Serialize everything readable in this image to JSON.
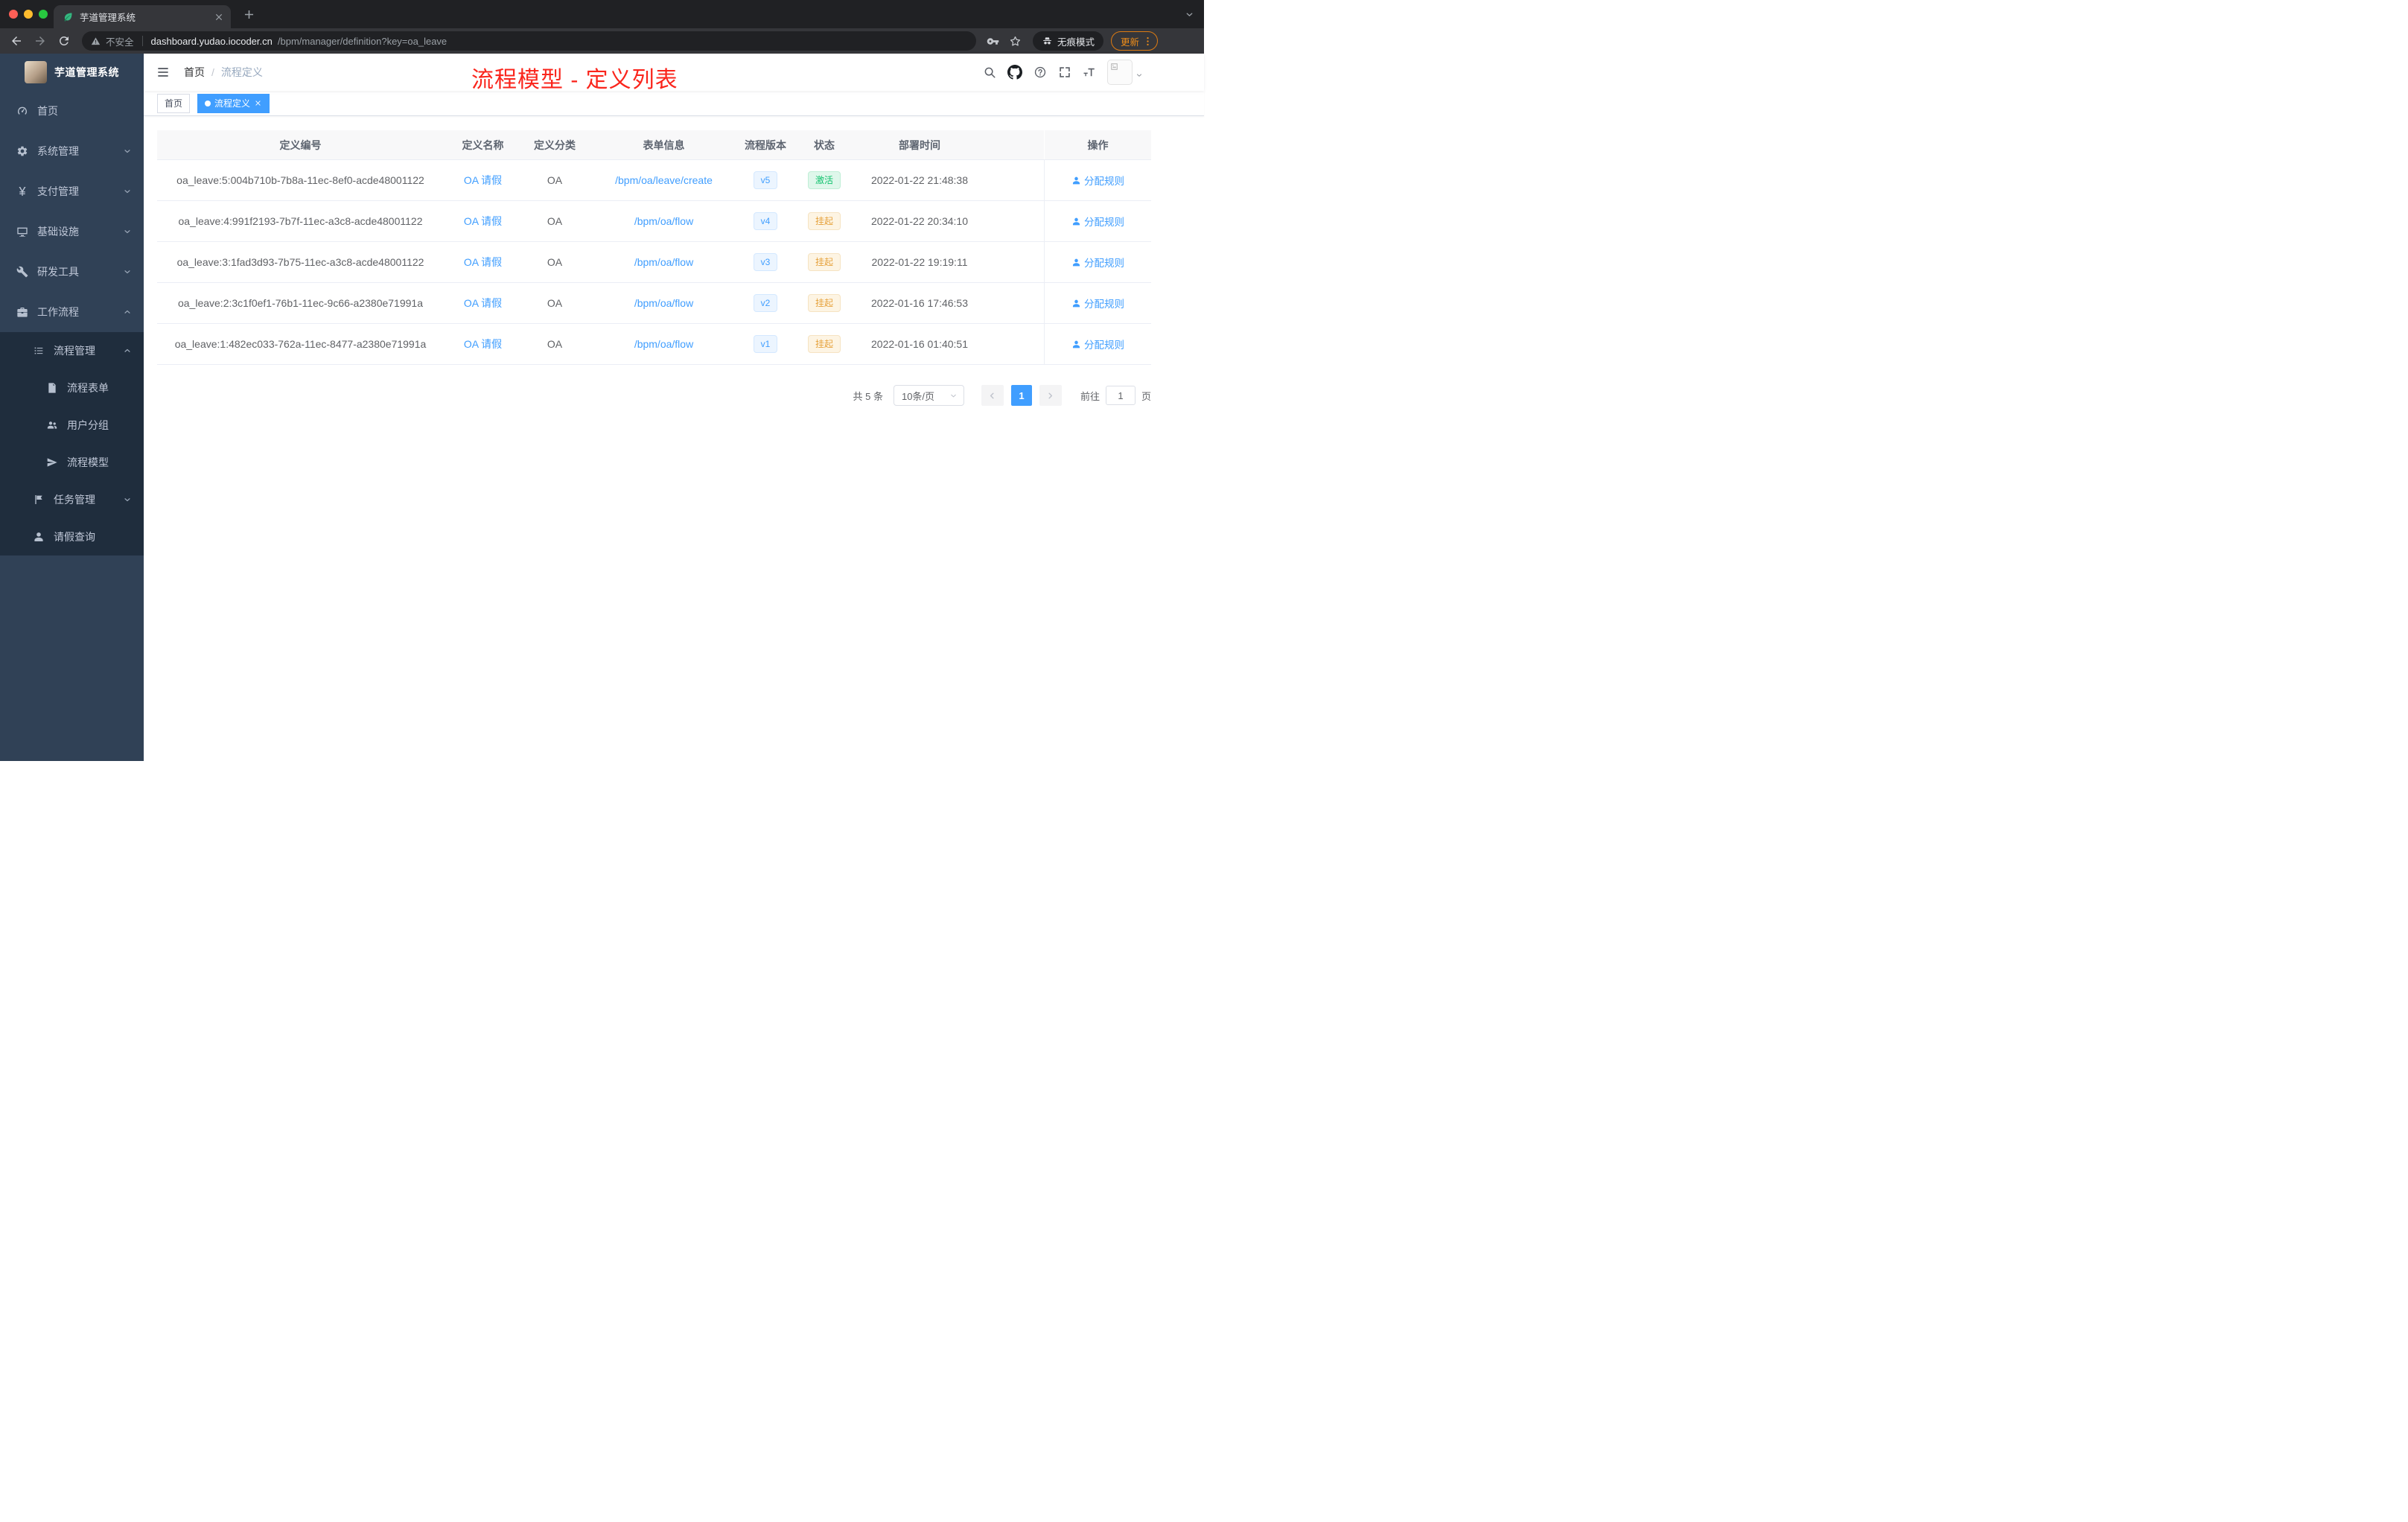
{
  "browser": {
    "tab_title": "芋道管理系统",
    "security_label": "不安全",
    "url_domain": "dashboard.yudao.iocoder.cn",
    "url_path": "/bpm/manager/definition?key=oa_leave",
    "incognito_label": "无痕模式",
    "update_label": "更新"
  },
  "sidebar": {
    "logo_title": "芋道管理系统",
    "items": [
      {
        "key": "home",
        "label": "首页",
        "icon": "dashboard",
        "level": 0
      },
      {
        "key": "system",
        "label": "系统管理",
        "icon": "gear",
        "level": 0,
        "chevron": "down"
      },
      {
        "key": "payment",
        "label": "支付管理",
        "icon": "yen",
        "level": 0,
        "chevron": "down"
      },
      {
        "key": "infrastructure",
        "label": "基础设施",
        "icon": "infra",
        "level": 0,
        "chevron": "down"
      },
      {
        "key": "dev-tools",
        "label": "研发工具",
        "icon": "tools",
        "level": 0,
        "chevron": "down"
      },
      {
        "key": "workflow",
        "label": "工作流程",
        "icon": "workflow",
        "level": 0,
        "chevron": "up"
      },
      {
        "key": "process-management",
        "label": "流程管理",
        "icon": "process",
        "level": 1,
        "chevron": "up",
        "sub": true
      },
      {
        "key": "process-form",
        "label": "流程表单",
        "icon": "form",
        "level": 2,
        "sub": true
      },
      {
        "key": "user-group",
        "label": "用户分组",
        "icon": "user-group",
        "level": 2,
        "sub": true
      },
      {
        "key": "process-model",
        "label": "流程模型",
        "icon": "paper-plane",
        "level": 2,
        "sub": true
      },
      {
        "key": "task-management",
        "label": "任务管理",
        "icon": "task",
        "level": 1,
        "chevron": "down",
        "sub": true
      },
      {
        "key": "leave-query",
        "label": "请假查询",
        "icon": "person",
        "level": 1,
        "sub": true
      }
    ]
  },
  "header": {
    "breadcrumb": [
      "首页",
      "流程定义"
    ],
    "separator": "/",
    "annotation": "流程模型 - 定义列表"
  },
  "tags": [
    {
      "label": "首页",
      "active": false
    },
    {
      "label": "流程定义",
      "active": true
    }
  ],
  "table": {
    "columns": [
      "定义编号",
      "定义名称",
      "定义分类",
      "表单信息",
      "流程版本",
      "状态",
      "部署时间",
      "操作"
    ],
    "rows": [
      {
        "id": "oa_leave:5:004b710b-7b8a-11ec-8ef0-acde48001122",
        "name": "OA 请假",
        "category": "OA",
        "form": "/bpm/oa/leave/create",
        "version": "v5",
        "status": "激活",
        "status_type": "success",
        "time": "2022-01-22 21:48:38",
        "action": "分配规则"
      },
      {
        "id": "oa_leave:4:991f2193-7b7f-11ec-a3c8-acde48001122",
        "name": "OA 请假",
        "category": "OA",
        "form": "/bpm/oa/flow",
        "version": "v4",
        "status": "挂起",
        "status_type": "warning",
        "time": "2022-01-22 20:34:10",
        "action": "分配规则"
      },
      {
        "id": "oa_leave:3:1fad3d93-7b75-11ec-a3c8-acde48001122",
        "name": "OA 请假",
        "category": "OA",
        "form": "/bpm/oa/flow",
        "version": "v3",
        "status": "挂起",
        "status_type": "warning",
        "time": "2022-01-22 19:19:11",
        "action": "分配规则"
      },
      {
        "id": "oa_leave:2:3c1f0ef1-76b1-11ec-9c66-a2380e71991a",
        "name": "OA 请假",
        "category": "OA",
        "form": "/bpm/oa/flow",
        "version": "v2",
        "status": "挂起",
        "status_type": "warning",
        "time": "2022-01-16 17:46:53",
        "action": "分配规则"
      },
      {
        "id": "oa_leave:1:482ec033-762a-11ec-8477-a2380e71991a",
        "name": "OA 请假",
        "category": "OA",
        "form": "/bpm/oa/flow",
        "version": "v1",
        "status": "挂起",
        "status_type": "warning",
        "time": "2022-01-16 01:40:51",
        "action": "分配规则"
      }
    ]
  },
  "pagination": {
    "total": "共 5 条",
    "page_size": "10条/页",
    "current_page": "1",
    "goto_label": "前往",
    "goto_value": "1",
    "unit_label": "页"
  },
  "colors": {
    "accent": "#409eff",
    "success_text": "#13ce66",
    "warning_text": "#e6a23c",
    "annotation_red": "#fa251c",
    "sidebar_bg": "#304156",
    "sidebar_submenu_bg": "#1f2d3d",
    "active_tag_bg": "#409eff"
  }
}
